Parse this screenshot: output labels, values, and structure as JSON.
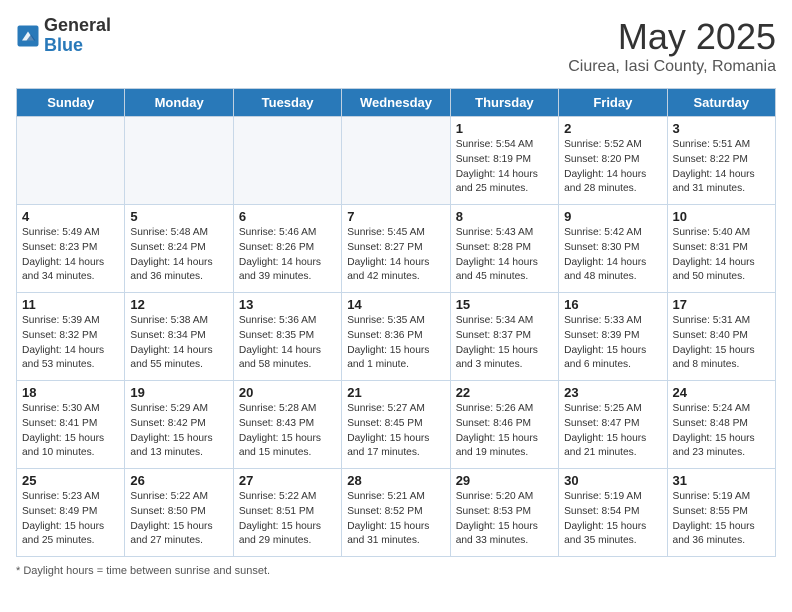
{
  "header": {
    "logo_general": "General",
    "logo_blue": "Blue",
    "month": "May 2025",
    "location": "Ciurea, Iasi County, Romania"
  },
  "days_of_week": [
    "Sunday",
    "Monday",
    "Tuesday",
    "Wednesday",
    "Thursday",
    "Friday",
    "Saturday"
  ],
  "footer": {
    "note": "Daylight hours"
  },
  "weeks": [
    [
      {
        "day": "",
        "info": ""
      },
      {
        "day": "",
        "info": ""
      },
      {
        "day": "",
        "info": ""
      },
      {
        "day": "",
        "info": ""
      },
      {
        "day": "1",
        "info": "Sunrise: 5:54 AM\nSunset: 8:19 PM\nDaylight: 14 hours\nand 25 minutes."
      },
      {
        "day": "2",
        "info": "Sunrise: 5:52 AM\nSunset: 8:20 PM\nDaylight: 14 hours\nand 28 minutes."
      },
      {
        "day": "3",
        "info": "Sunrise: 5:51 AM\nSunset: 8:22 PM\nDaylight: 14 hours\nand 31 minutes."
      }
    ],
    [
      {
        "day": "4",
        "info": "Sunrise: 5:49 AM\nSunset: 8:23 PM\nDaylight: 14 hours\nand 34 minutes."
      },
      {
        "day": "5",
        "info": "Sunrise: 5:48 AM\nSunset: 8:24 PM\nDaylight: 14 hours\nand 36 minutes."
      },
      {
        "day": "6",
        "info": "Sunrise: 5:46 AM\nSunset: 8:26 PM\nDaylight: 14 hours\nand 39 minutes."
      },
      {
        "day": "7",
        "info": "Sunrise: 5:45 AM\nSunset: 8:27 PM\nDaylight: 14 hours\nand 42 minutes."
      },
      {
        "day": "8",
        "info": "Sunrise: 5:43 AM\nSunset: 8:28 PM\nDaylight: 14 hours\nand 45 minutes."
      },
      {
        "day": "9",
        "info": "Sunrise: 5:42 AM\nSunset: 8:30 PM\nDaylight: 14 hours\nand 48 minutes."
      },
      {
        "day": "10",
        "info": "Sunrise: 5:40 AM\nSunset: 8:31 PM\nDaylight: 14 hours\nand 50 minutes."
      }
    ],
    [
      {
        "day": "11",
        "info": "Sunrise: 5:39 AM\nSunset: 8:32 PM\nDaylight: 14 hours\nand 53 minutes."
      },
      {
        "day": "12",
        "info": "Sunrise: 5:38 AM\nSunset: 8:34 PM\nDaylight: 14 hours\nand 55 minutes."
      },
      {
        "day": "13",
        "info": "Sunrise: 5:36 AM\nSunset: 8:35 PM\nDaylight: 14 hours\nand 58 minutes."
      },
      {
        "day": "14",
        "info": "Sunrise: 5:35 AM\nSunset: 8:36 PM\nDaylight: 15 hours\nand 1 minute."
      },
      {
        "day": "15",
        "info": "Sunrise: 5:34 AM\nSunset: 8:37 PM\nDaylight: 15 hours\nand 3 minutes."
      },
      {
        "day": "16",
        "info": "Sunrise: 5:33 AM\nSunset: 8:39 PM\nDaylight: 15 hours\nand 6 minutes."
      },
      {
        "day": "17",
        "info": "Sunrise: 5:31 AM\nSunset: 8:40 PM\nDaylight: 15 hours\nand 8 minutes."
      }
    ],
    [
      {
        "day": "18",
        "info": "Sunrise: 5:30 AM\nSunset: 8:41 PM\nDaylight: 15 hours\nand 10 minutes."
      },
      {
        "day": "19",
        "info": "Sunrise: 5:29 AM\nSunset: 8:42 PM\nDaylight: 15 hours\nand 13 minutes."
      },
      {
        "day": "20",
        "info": "Sunrise: 5:28 AM\nSunset: 8:43 PM\nDaylight: 15 hours\nand 15 minutes."
      },
      {
        "day": "21",
        "info": "Sunrise: 5:27 AM\nSunset: 8:45 PM\nDaylight: 15 hours\nand 17 minutes."
      },
      {
        "day": "22",
        "info": "Sunrise: 5:26 AM\nSunset: 8:46 PM\nDaylight: 15 hours\nand 19 minutes."
      },
      {
        "day": "23",
        "info": "Sunrise: 5:25 AM\nSunset: 8:47 PM\nDaylight: 15 hours\nand 21 minutes."
      },
      {
        "day": "24",
        "info": "Sunrise: 5:24 AM\nSunset: 8:48 PM\nDaylight: 15 hours\nand 23 minutes."
      }
    ],
    [
      {
        "day": "25",
        "info": "Sunrise: 5:23 AM\nSunset: 8:49 PM\nDaylight: 15 hours\nand 25 minutes."
      },
      {
        "day": "26",
        "info": "Sunrise: 5:22 AM\nSunset: 8:50 PM\nDaylight: 15 hours\nand 27 minutes."
      },
      {
        "day": "27",
        "info": "Sunrise: 5:22 AM\nSunset: 8:51 PM\nDaylight: 15 hours\nand 29 minutes."
      },
      {
        "day": "28",
        "info": "Sunrise: 5:21 AM\nSunset: 8:52 PM\nDaylight: 15 hours\nand 31 minutes."
      },
      {
        "day": "29",
        "info": "Sunrise: 5:20 AM\nSunset: 8:53 PM\nDaylight: 15 hours\nand 33 minutes."
      },
      {
        "day": "30",
        "info": "Sunrise: 5:19 AM\nSunset: 8:54 PM\nDaylight: 15 hours\nand 35 minutes."
      },
      {
        "day": "31",
        "info": "Sunrise: 5:19 AM\nSunset: 8:55 PM\nDaylight: 15 hours\nand 36 minutes."
      }
    ]
  ]
}
